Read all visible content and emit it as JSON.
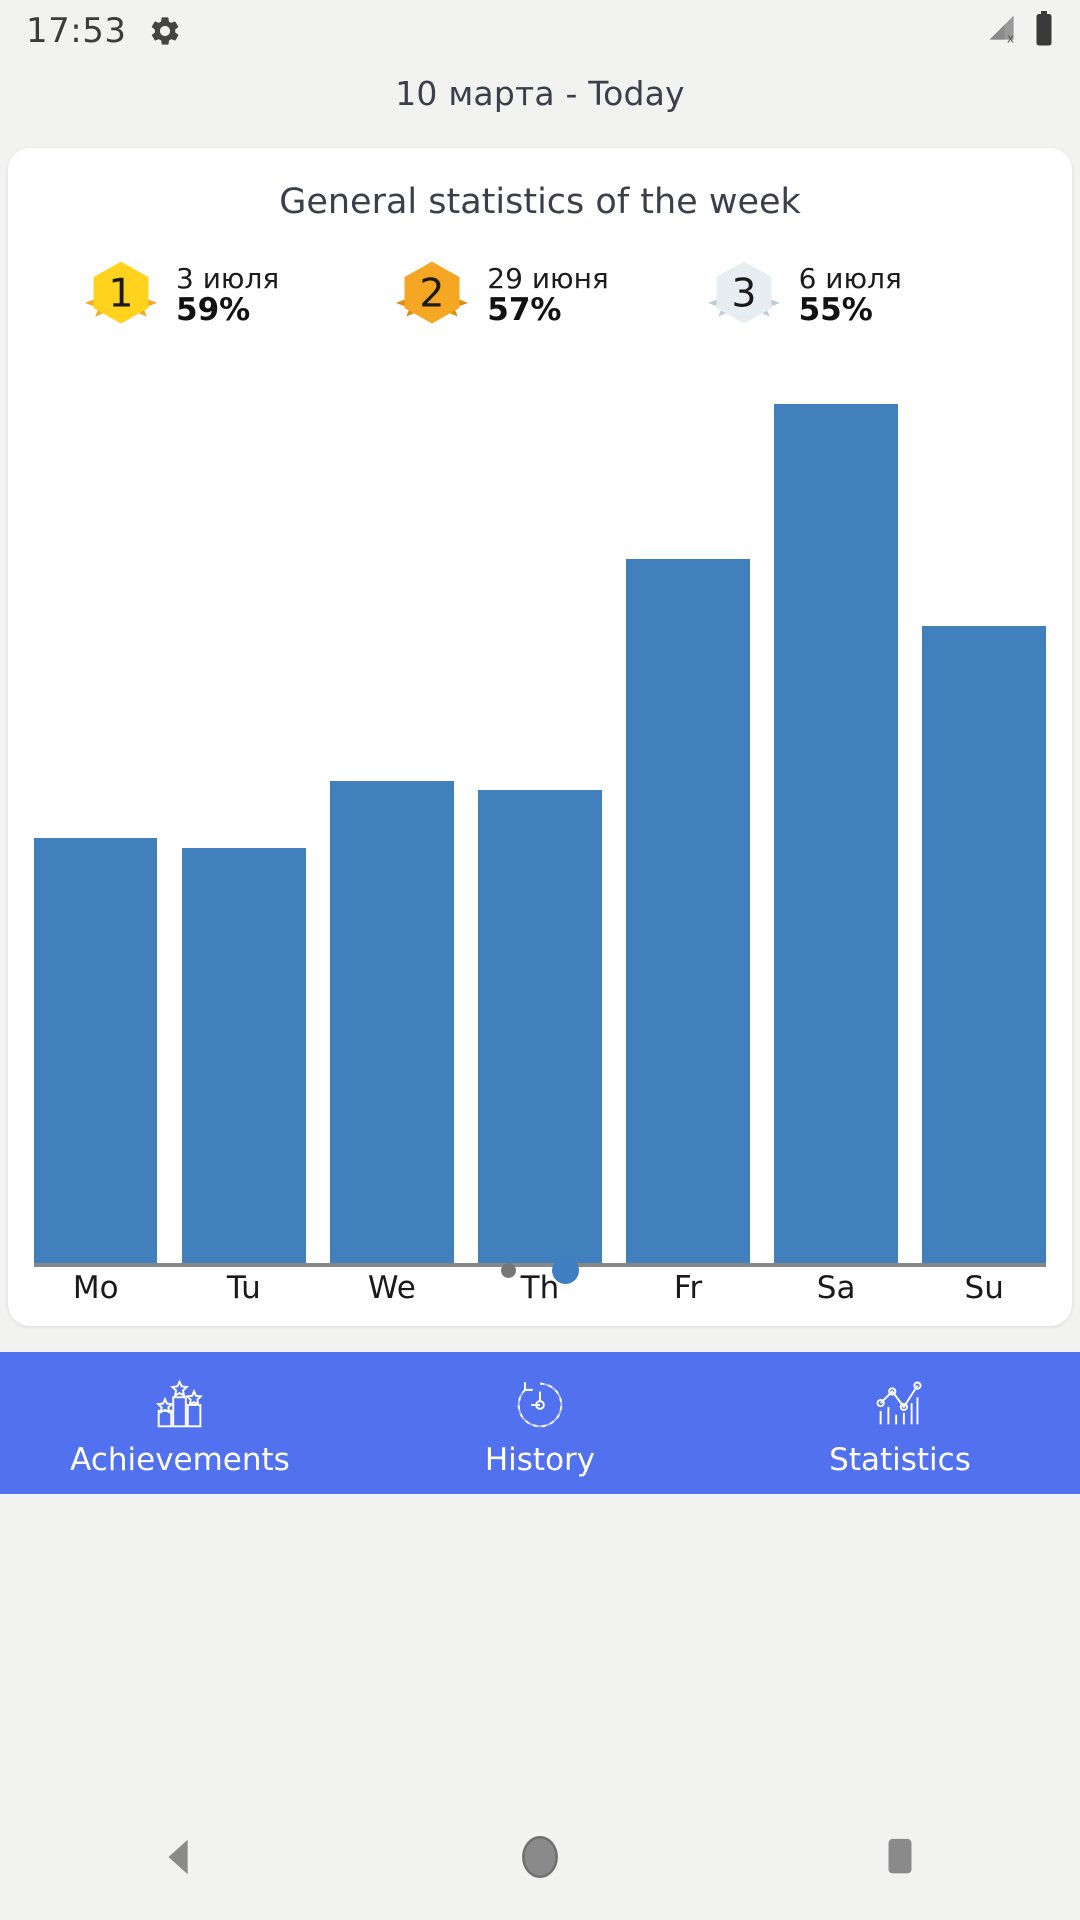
{
  "status_bar": {
    "time": "17:53",
    "gear_icon": "gear-icon",
    "signal_icon": "signal-no-service-icon",
    "battery_icon": "battery-full-icon"
  },
  "header": {
    "title": "10 марта - Today"
  },
  "card": {
    "title": "General statistics of the week",
    "medals": [
      {
        "rank": "1",
        "date": "3 июля",
        "percent": "59%",
        "color": "#FFD21E",
        "ribbon": "#F5A623",
        "num_color": "#1a1a1a"
      },
      {
        "rank": "2",
        "date": "29 июня",
        "percent": "57%",
        "color": "#F5A623",
        "ribbon": "#E08C10",
        "num_color": "#1a1a1a"
      },
      {
        "rank": "3",
        "date": "6 июля",
        "percent": "55%",
        "color": "#E8EDF2",
        "ribbon": "#C3CDD6",
        "num_color": "#1a1a1a"
      }
    ],
    "pagination": {
      "total": 2,
      "active_index": 1
    }
  },
  "chart_data": {
    "type": "bar",
    "title": "General statistics of the week",
    "categories": [
      "Mo",
      "Tu",
      "We",
      "Th",
      "Fr",
      "Sa",
      "Su"
    ],
    "values": [
      44,
      43,
      50,
      49,
      73,
      89,
      66
    ],
    "bar_color": "#4180bd",
    "xlabel": "",
    "ylabel": "",
    "ylim": [
      0,
      100
    ],
    "grid": false,
    "legend": "none",
    "axis_line_color": "#888888"
  },
  "bottom_nav": {
    "background": "#5271ef",
    "tabs": [
      {
        "label": "Achievements",
        "icon": "podium-stars-icon"
      },
      {
        "label": "History",
        "icon": "clock-history-icon"
      },
      {
        "label": "Statistics",
        "icon": "chart-statistics-icon"
      }
    ]
  },
  "system_nav": {
    "back": "back-triangle-icon",
    "home": "home-circle-icon",
    "recents": "recents-square-icon"
  }
}
